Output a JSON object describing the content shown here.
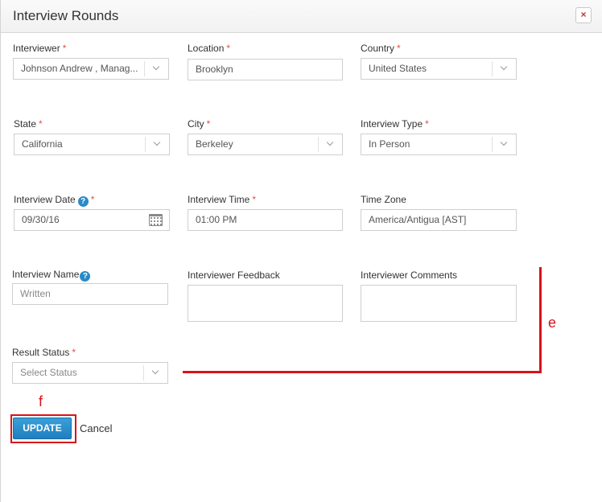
{
  "dialog": {
    "title": "Interview Rounds",
    "close_symbol": "×"
  },
  "required_marker": "*",
  "help_symbol": "?",
  "fields": {
    "interviewer": {
      "label": "Interviewer",
      "value": "Johnson Andrew , Manag..."
    },
    "location": {
      "label": "Location",
      "value": "Brooklyn"
    },
    "country": {
      "label": "Country",
      "value": "United States"
    },
    "state": {
      "label": "State",
      "value": "California"
    },
    "city": {
      "label": "City",
      "value": "Berkeley"
    },
    "interview_type": {
      "label": "Interview Type",
      "value": "In Person"
    },
    "interview_date": {
      "label": "Interview Date",
      "value": "09/30/16"
    },
    "interview_time": {
      "label": "Interview Time",
      "value": "01:00 PM"
    },
    "time_zone": {
      "label": "Time Zone",
      "value": "America/Antigua [AST]"
    },
    "interview_name": {
      "label": "Interview Name",
      "placeholder": "Written"
    },
    "interviewer_feedback": {
      "label": "Interviewer Feedback",
      "value": ""
    },
    "interviewer_comments": {
      "label": "Interviewer Comments",
      "value": ""
    },
    "result_status": {
      "label": "Result Status",
      "placeholder": "Select Status"
    }
  },
  "actions": {
    "update_label": "UPDATE",
    "cancel_label": "Cancel"
  },
  "annotations": {
    "e": "e",
    "f": "f",
    "color": "#d9121b"
  },
  "colors": {
    "primary_button": "#2a8ac8",
    "required": "#d9534f"
  }
}
